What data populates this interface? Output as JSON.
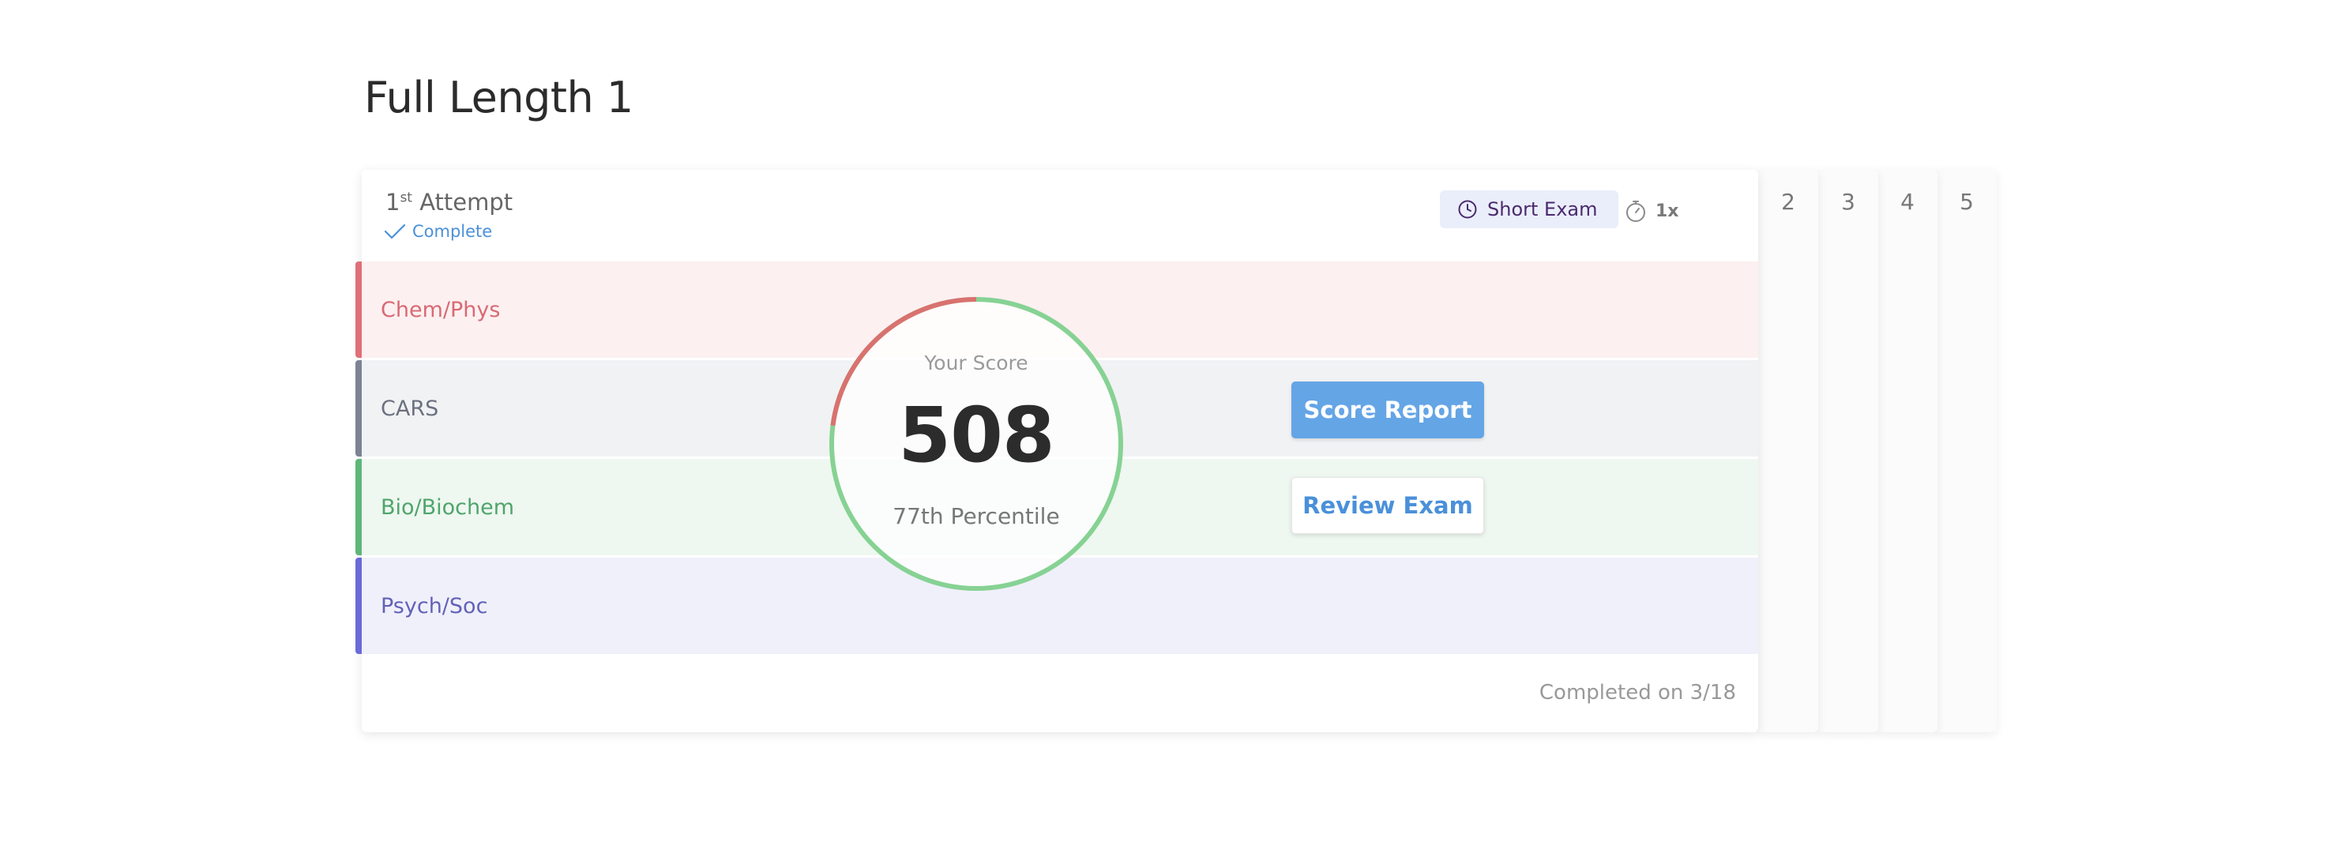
{
  "page": {
    "title": "Full Length 1"
  },
  "attempt": {
    "number": "1",
    "ordinal_suffix": "st",
    "label": "Attempt",
    "status": "Complete",
    "exam_type": "Short Exam",
    "speed": "1x",
    "completed_on": "Completed on 3/18"
  },
  "sections": [
    {
      "name": "Chem/Phys",
      "color": "#e06f78"
    },
    {
      "name": "CARS",
      "color": "#7d8294"
    },
    {
      "name": "Bio/Biochem",
      "color": "#5fb67a"
    },
    {
      "name": "Psych/Soc",
      "color": "#6a6ad8"
    }
  ],
  "score": {
    "label": "Your Score",
    "value": "508",
    "percentile": "77th Percentile",
    "ring_red_fraction": 0.23,
    "ring_colors": {
      "red": "#d9726f",
      "green": "#86d293"
    }
  },
  "actions": {
    "score_report": "Score Report",
    "review_exam": "Review Exam"
  },
  "attempt_tabs": [
    "2",
    "3",
    "4",
    "5"
  ],
  "icons": {
    "complete": "check-icon",
    "exam_type": "clock-icon",
    "speed": "stopwatch-icon"
  },
  "colors": {
    "accent_blue": "#4a90d9",
    "button_blue": "#64a5e6"
  }
}
